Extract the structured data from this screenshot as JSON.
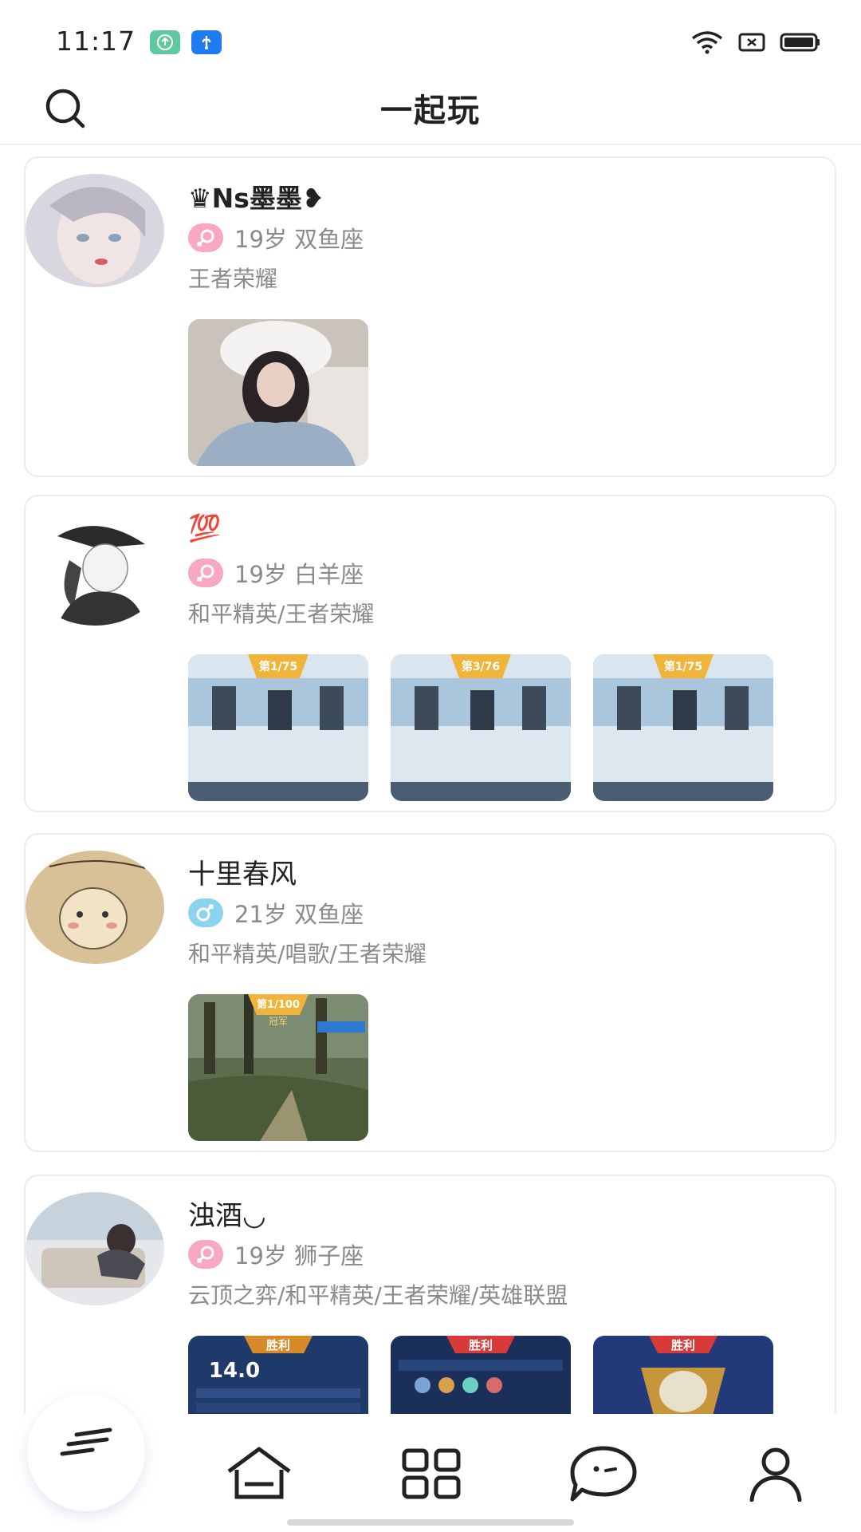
{
  "status_bar": {
    "time": "11:17"
  },
  "header": {
    "title": "一起玩"
  },
  "users": [
    {
      "nickname": "♛Ns墨墨❥",
      "gender": "female",
      "gender_symbol": "♀",
      "meta": "19岁 双鱼座",
      "games": "王者荣耀"
    },
    {
      "nickname": "💯",
      "gender": "female",
      "gender_symbol": "♀",
      "meta": "19岁 白羊座",
      "games": "和平精英/王者荣耀"
    },
    {
      "nickname": "十里春风",
      "gender": "male",
      "gender_symbol": "♂",
      "meta": "21岁 双鱼座",
      "games": "和平精英/唱歌/王者荣耀"
    },
    {
      "nickname": "浊酒◡",
      "gender": "female",
      "gender_symbol": "♀",
      "meta": "19岁 狮子座",
      "games": "云顶之弈/和平精英/王者荣耀/英雄联盟"
    }
  ],
  "photo_text": {
    "p2a": "第1/75",
    "p2b": "第3/76",
    "p2c": "第1/75",
    "p3a": "第1/100",
    "p3b": "冠军",
    "p4a": "14.0",
    "p4b": "胜利",
    "p4c": "胜利",
    "p4d": "胜利"
  },
  "bottom_nav": {
    "items": [
      "feed",
      "home",
      "apps",
      "messages",
      "profile"
    ]
  }
}
